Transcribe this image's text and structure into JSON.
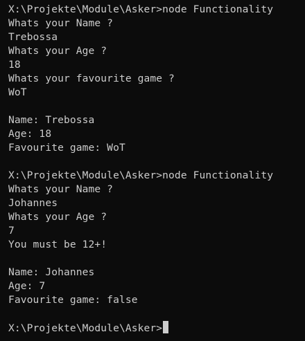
{
  "window": {
    "type": "terminal",
    "background": "#0c0c0c",
    "foreground": "#cccccc"
  },
  "session1": {
    "prompt_command": "X:\\Projekte\\Module\\Asker>node Functionality",
    "q_name": "Whats your Name ?",
    "a_name": "Trebossa",
    "q_age": "Whats your Age ?",
    "a_age": "18",
    "q_game": "Whats your favourite game ?",
    "a_game": "WoT",
    "out_name": "Name: Trebossa",
    "out_age": "Age: 18",
    "out_game": "Favourite game: WoT"
  },
  "session2": {
    "prompt_command": "X:\\Projekte\\Module\\Asker>node Functionality",
    "q_name": "Whats your Name ?",
    "a_name": "Johannes",
    "q_age": "Whats your Age ?",
    "a_age": "7",
    "warning": "You must be 12+!",
    "out_name": "Name: Johannes",
    "out_age": "Age: 7",
    "out_game": "Favourite game: false"
  },
  "current_prompt": "X:\\Projekte\\Module\\Asker>"
}
